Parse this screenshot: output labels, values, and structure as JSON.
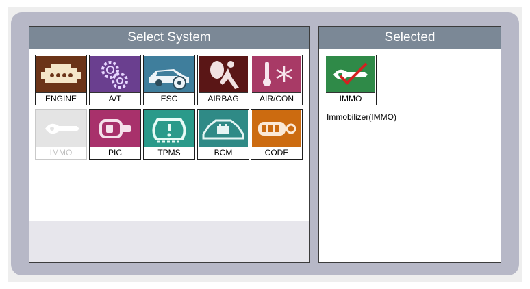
{
  "select_panel": {
    "title": "Select System"
  },
  "selected_panel": {
    "title": "Selected"
  },
  "systems": [
    {
      "label": "ENGINE",
      "icon": "engine-icon",
      "color": "#6b3418"
    },
    {
      "label": "A/T",
      "icon": "gears-icon",
      "color": "#6a3f8f"
    },
    {
      "label": "ESC",
      "icon": "car-brake-icon",
      "color": "#3f7e9c"
    },
    {
      "label": "AIRBAG",
      "icon": "airbag-icon",
      "color": "#5a1616"
    },
    {
      "label": "AIR/CON",
      "icon": "aircon-icon",
      "color": "#a83a66"
    },
    {
      "label": "IMMO",
      "icon": "key-icon",
      "color": "#e4e4e4",
      "disabled": true
    },
    {
      "label": "PIC",
      "icon": "smart-key-icon",
      "color": "#a8316b"
    },
    {
      "label": "TPMS",
      "icon": "tire-pressure-icon",
      "color": "#2a9a8a"
    },
    {
      "label": "BCM",
      "icon": "car-battery-icon",
      "color": "#2f8a86"
    },
    {
      "label": "CODE",
      "icon": "remote-key-icon",
      "color": "#cc6b10"
    }
  ],
  "selected": {
    "label": "IMMO",
    "name": "Immobilizer(IMMO)",
    "icon": "key-check-icon",
    "color": "#2f8a48"
  }
}
